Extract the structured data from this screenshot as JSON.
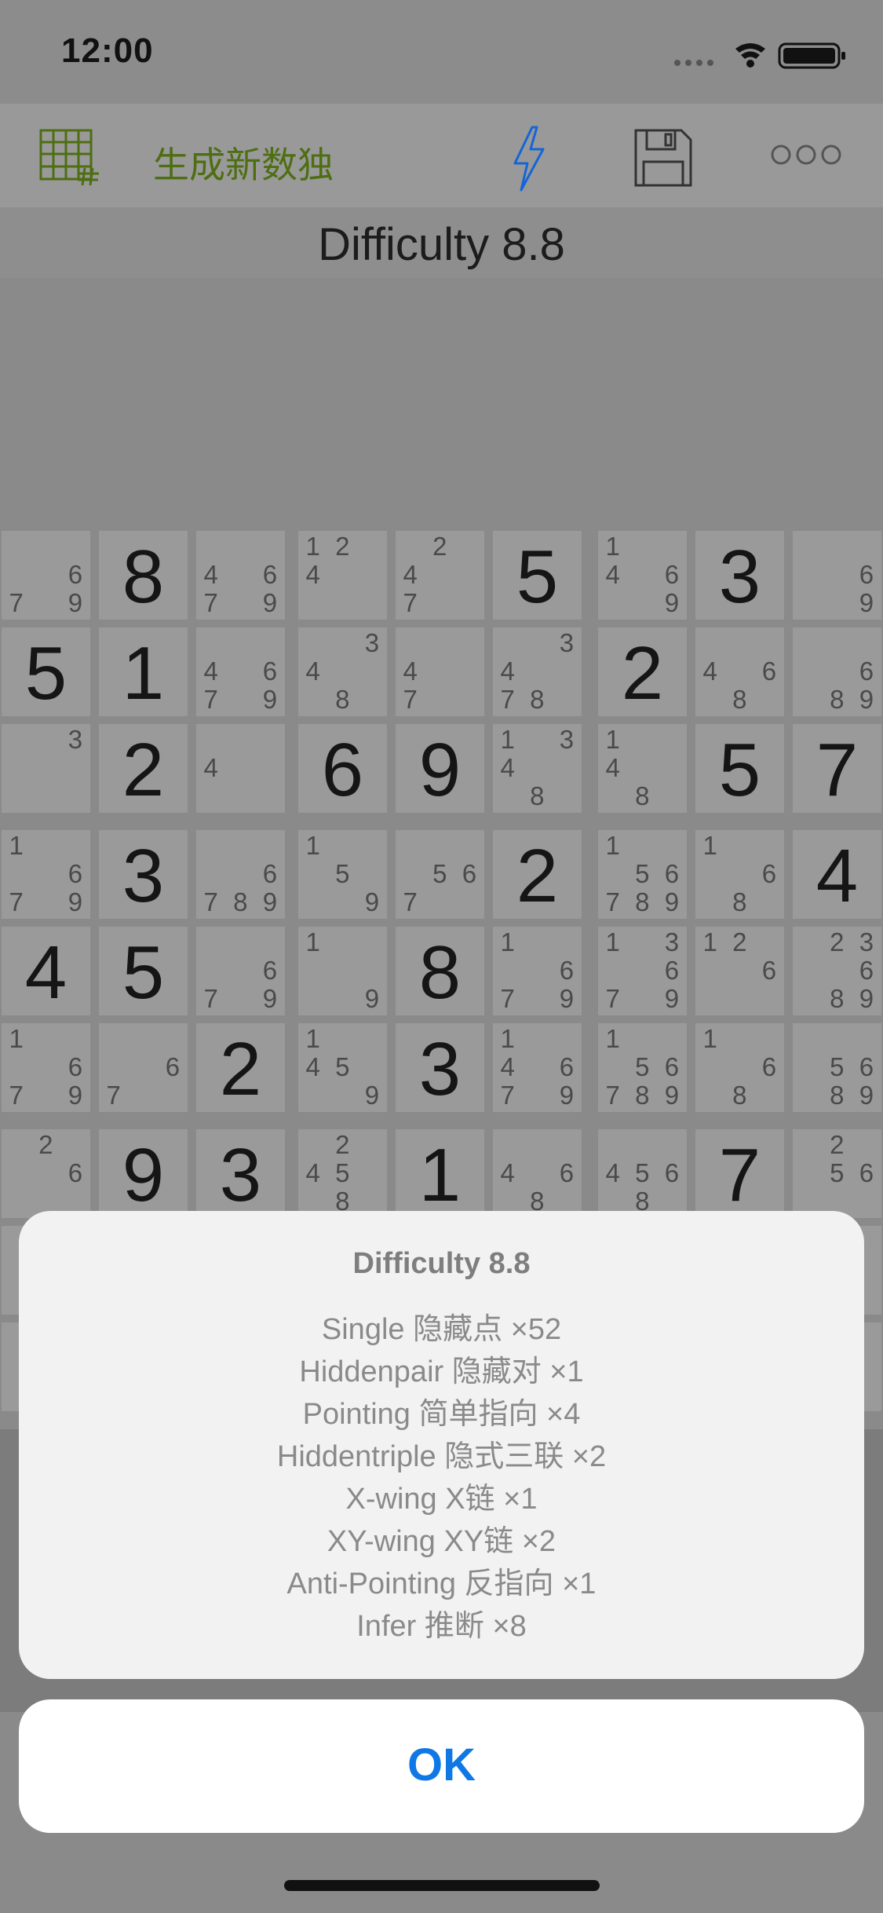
{
  "status": {
    "time": "12:00",
    "icons": [
      "signal-icon",
      "wifi-icon",
      "battery-icon"
    ]
  },
  "toolbar": {
    "grid_icon": "grid-hash-icon",
    "generate_label": "生成新数独",
    "bolt_icon": "lightning-bolt-icon",
    "save_icon": "floppy-disk-icon",
    "more_icon": "ellipsis-icon",
    "accent_color": "#4e6e12",
    "bolt_color": "#1565d8"
  },
  "difficulty_header": "Difficulty 8.8",
  "sudoku": {
    "rows": [
      [
        {
          "c": "679"
        },
        {
          "v": "8"
        },
        {
          "c": "4679"
        },
        {
          "c": "124"
        },
        {
          "c": "247"
        },
        {
          "v": "5"
        },
        {
          "c": "1469"
        },
        {
          "v": "3"
        },
        {
          "c": "69"
        }
      ],
      [
        {
          "v": "5"
        },
        {
          "v": "1"
        },
        {
          "c": "4679"
        },
        {
          "c": "348"
        },
        {
          "c": "47"
        },
        {
          "c": "3478"
        },
        {
          "v": "2"
        },
        {
          "c": "468"
        },
        {
          "c": "689"
        }
      ],
      [
        {
          "c": "3"
        },
        {
          "v": "2"
        },
        {
          "c": "4"
        },
        {
          "v": "6"
        },
        {
          "v": "9"
        },
        {
          "c": "1348"
        },
        {
          "c": "148"
        },
        {
          "v": "5"
        },
        {
          "v": "7"
        }
      ],
      [
        {
          "c": "1679"
        },
        {
          "v": "3"
        },
        {
          "c": "6789"
        },
        {
          "c": "159"
        },
        {
          "c": "567"
        },
        {
          "v": "2"
        },
        {
          "c": "156789"
        },
        {
          "c": "168"
        },
        {
          "v": "4"
        }
      ],
      [
        {
          "v": "4"
        },
        {
          "v": "5"
        },
        {
          "c": "679"
        },
        {
          "c": "19"
        },
        {
          "v": "8"
        },
        {
          "c": "1679"
        },
        {
          "c": "13679"
        },
        {
          "c": "126"
        },
        {
          "c": "23689"
        }
      ],
      [
        {
          "c": "1679"
        },
        {
          "c": "67"
        },
        {
          "v": "2"
        },
        {
          "c": "1459"
        },
        {
          "v": "3"
        },
        {
          "c": "14679"
        },
        {
          "c": "156789"
        },
        {
          "c": "168"
        },
        {
          "c": "5689"
        }
      ],
      [
        {
          "c": "26"
        },
        {
          "v": "9"
        },
        {
          "v": "3"
        },
        {
          "c": "2458"
        },
        {
          "v": "1"
        },
        {
          "c": "468"
        },
        {
          "c": "4568"
        },
        {
          "v": "7"
        },
        {
          "c": "256"
        }
      ],
      [
        {
          "c": ""
        },
        {
          "c": ""
        },
        {
          "c": ""
        },
        {
          "c": ""
        },
        {
          "c": ""
        },
        {
          "c": ""
        },
        {
          "c": ""
        },
        {
          "c": ""
        },
        {
          "c": ""
        }
      ],
      [
        {
          "c": ""
        },
        {
          "c": ""
        },
        {
          "c": ""
        },
        {
          "c": ""
        },
        {
          "c": ""
        },
        {
          "c": ""
        },
        {
          "c": ""
        },
        {
          "c": ""
        },
        {
          "c": ""
        }
      ]
    ]
  },
  "alert": {
    "title": "Difficulty 8.8",
    "lines": [
      "Single 隐藏点 ×52",
      "Hiddenpair 隐藏对 ×1",
      "Pointing 简单指向 ×4",
      "Hiddentriple 隐式三联 ×2",
      "X-wing X链 ×1",
      "XY-wing XY链 ×2",
      "Anti-Pointing 反指向 ×1",
      "Infer 推断 ×8"
    ],
    "ok_label": "OK",
    "ok_color": "#0f78e6"
  }
}
